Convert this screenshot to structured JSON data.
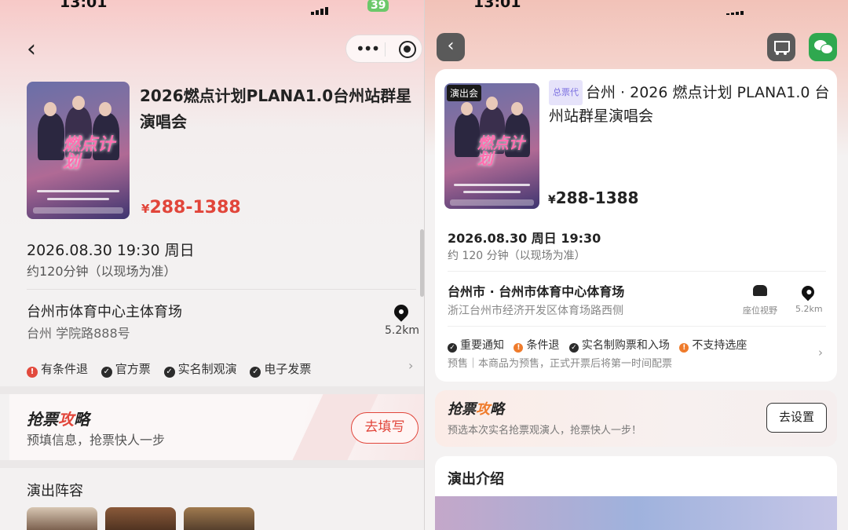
{
  "left": {
    "status": {
      "time": "13:01",
      "battery": "39"
    },
    "event": {
      "poster_text": "燃点计划",
      "title": "2026燃点计划PLANA1.0台州站群星演唱会",
      "price_symbol": "¥",
      "price": "288-1388",
      "date": "2026.08.30 19:30 周日",
      "duration": "约120分钟（以现场为准）",
      "venue": "台州市体育中心主体育场",
      "address": "台州 学院路888号",
      "distance": "5.2km",
      "tags": [
        {
          "icon": "!",
          "label": "有条件退"
        },
        {
          "icon": "✓",
          "label": "官方票"
        },
        {
          "icon": "✓",
          "label": "实名制观演"
        },
        {
          "icon": "✓",
          "label": "电子发票"
        }
      ]
    },
    "promo": {
      "title_a": "抢票",
      "title_b": "攻",
      "title_c": "略",
      "subtitle": "预填信息，抢票快人一步",
      "button": "去填写"
    },
    "cast_title": "演出阵容",
    "accent": "#e1453a"
  },
  "right": {
    "status": {
      "time": "13:01"
    },
    "event": {
      "ribbon": "演出会",
      "badge": "总票代",
      "title": "台州 · 2026 燃点计划 PLANA1.0 台州站群星演唱会",
      "price_symbol": "¥",
      "price": "288-1388",
      "date": "2026.08.30 周日 19:30",
      "duration": "约 120 分钟（以现场为准）",
      "venue": "台州市 · 台州市体育中心体育场",
      "address": "浙江台州市经济开发区体育场路西侧",
      "seat_label": "座位视野",
      "distance": "5.2km",
      "tags": [
        {
          "icon": "✓",
          "color": "blk",
          "label": "重要通知"
        },
        {
          "icon": "!",
          "color": "org",
          "label": "条件退"
        },
        {
          "icon": "✓",
          "color": "blk",
          "label": "实名制购票和入场"
        },
        {
          "icon": "!",
          "color": "org",
          "label": "不支持选座"
        }
      ],
      "presale": "预售｜本商品为预售，正式开票后将第一时间配票"
    },
    "promo": {
      "title_a": "抢票",
      "title_b": "攻",
      "title_c": "略",
      "subtitle": "预选本次实名抢票观演人，抢票快人一步！",
      "button": "去设置"
    },
    "intro_title": "演出介绍",
    "accent": "#ef7b2b"
  }
}
